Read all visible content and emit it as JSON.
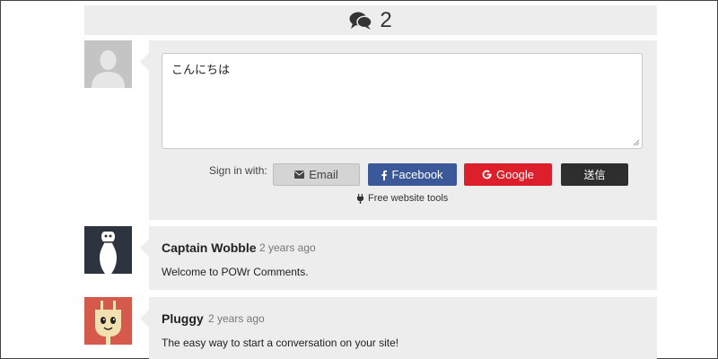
{
  "thread": {
    "comment_count": "2"
  },
  "composer": {
    "text": "こんにちは",
    "signin_label": "Sign in with:",
    "buttons": {
      "email": "Email",
      "facebook": "Facebook",
      "google": "Google",
      "send": "送信"
    },
    "tools_link": "Free website tools"
  },
  "comments": [
    {
      "author": "Captain Wobble",
      "time": "2 years ago",
      "text": "Welcome to POWr Comments.",
      "avatar_icon": "bowling-pin-avatar-icon"
    },
    {
      "author": "Pluggy",
      "time": "2 years ago",
      "text": "The easy way to start a conversation on your site!",
      "avatar_icon": "plug-avatar-icon"
    }
  ],
  "colors": {
    "panel_bg": "#eeeded",
    "facebook": "#3b5998",
    "google": "#dd1f2c",
    "send": "#2e2e2e",
    "email": "#d4d4d4"
  }
}
